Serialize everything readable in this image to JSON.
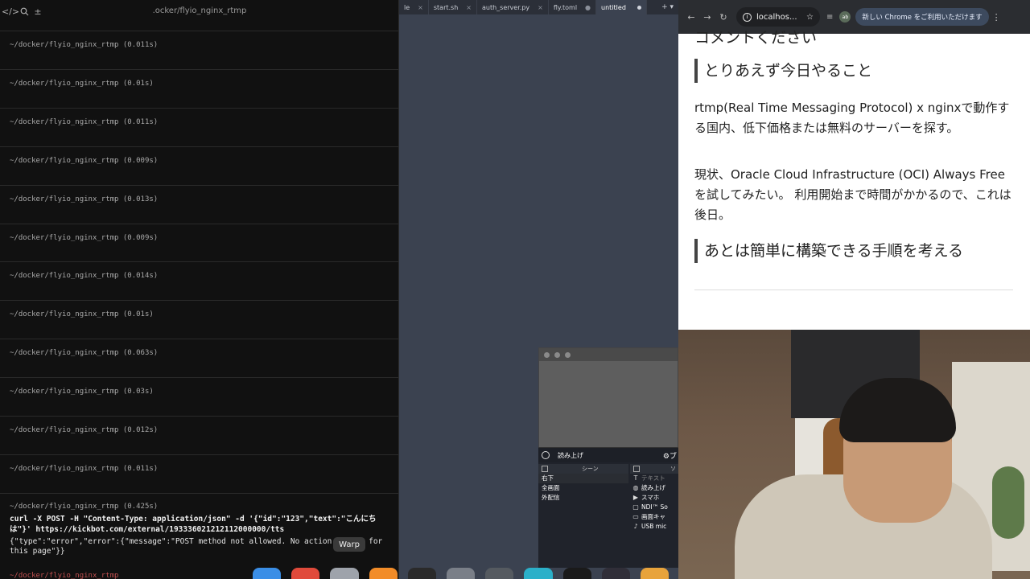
{
  "terminal": {
    "title": ".ocker/flyio_nginx_rtmp",
    "toolbar_icons": [
      "code-icon",
      "search-icon",
      "plus-icon"
    ],
    "blocks": [
      "~/docker/flyio_nginx_rtmp (0.011s)",
      "~/docker/flyio_nginx_rtmp (0.01s)",
      "~/docker/flyio_nginx_rtmp (0.011s)",
      "~/docker/flyio_nginx_rtmp (0.009s)",
      "~/docker/flyio_nginx_rtmp (0.013s)",
      "~/docker/flyio_nginx_rtmp (0.009s)",
      "~/docker/flyio_nginx_rtmp (0.014s)",
      "~/docker/flyio_nginx_rtmp (0.01s)",
      "~/docker/flyio_nginx_rtmp (0.063s)",
      "~/docker/flyio_nginx_rtmp (0.03s)",
      "~/docker/flyio_nginx_rtmp (0.012s)",
      "~/docker/flyio_nginx_rtmp (0.011s)"
    ],
    "last_block_path": "~/docker/flyio_nginx_rtmp (0.425s)",
    "command": "curl -X POST -H \"Content-Type: application/json\" -d '{\"id\":\"123\",\"text\":\"こんにちは\"}' https://kickbot.com/external/193336021212112000000/tts",
    "response": "{\"type\":\"error\",\"error\":{\"message\":\"POST method not allowed. No action        for this page\"}}",
    "next_prompt": "~/docker/flyio_nginx_rtmp"
  },
  "editor": {
    "tabs": [
      {
        "label": "le",
        "active": false
      },
      {
        "label": "start.sh",
        "active": false
      },
      {
        "label": "auth_server.py",
        "active": false
      },
      {
        "label": "fly.toml",
        "active": false
      },
      {
        "label": "untitled",
        "active": true
      }
    ],
    "menu": "+ ▾"
  },
  "obs": {
    "title": "読み上げ",
    "scenes_header": "シーン",
    "sources_header": "ソ",
    "scenes": [
      "右下",
      "全画面",
      "外配信"
    ],
    "sources": [
      {
        "icon": "T",
        "label": "テキスト",
        "dim": true
      },
      {
        "icon": "◍",
        "label": "読み上げ",
        "dim": false
      },
      {
        "icon": "▶",
        "label": "スマホ",
        "dim": false
      },
      {
        "icon": "▢",
        "label": "NDI™ So",
        "dim": false
      },
      {
        "icon": "▭",
        "label": "画面キャ",
        "dim": false
      },
      {
        "icon": "♪",
        "label": "USB mic",
        "dim": false
      }
    ],
    "settings_label": "⚙ブ"
  },
  "browser": {
    "url": "localhos...",
    "update_button": "新しい Chrome をご利用いただけます",
    "profile": "ab",
    "cut_heading": "コメントください",
    "heading1": "とりあえず今日やること",
    "para1": "rtmp(Real Time Messaging Protocol) x nginxで動作する国内、低下価格または無料のサーバーを探す。",
    "para2": "現状、Oracle Cloud Infrastructure (OCI) Always Freeを試してみたい。 利用開始まで時間がかかるので、これは後日。",
    "heading2": "あとは簡単に構築できる手順を考える"
  },
  "dock": {
    "tooltip": "Warp",
    "icons": [
      {
        "name": "finder-icon",
        "color": "#3a8ee6"
      },
      {
        "name": "chrome-icon",
        "color": "#e04a3b"
      },
      {
        "name": "app-icon",
        "color": "#9ea3ab"
      },
      {
        "name": "sublime-icon",
        "color": "#f28c28"
      },
      {
        "name": "terminal-icon",
        "color": "#2a2a2a"
      },
      {
        "name": "safari-icon",
        "color": "#7a7f88"
      },
      {
        "name": "app2-icon",
        "color": "#555a60"
      },
      {
        "name": "app3-icon",
        "color": "#2bb0c9"
      },
      {
        "name": "app4-icon",
        "color": "#1a1a1a"
      },
      {
        "name": "obs-icon",
        "color": "#302e38"
      },
      {
        "name": "chrome-canary-icon",
        "color": "#e8a33b"
      }
    ]
  }
}
